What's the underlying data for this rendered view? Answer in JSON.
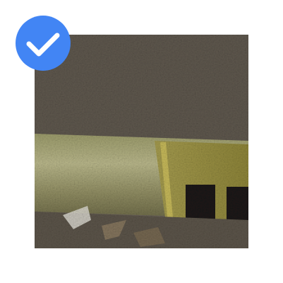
{
  "tile": {
    "selected": true,
    "accent_color": "#4285f4",
    "check_color": "#ffffff"
  },
  "icons": {
    "selection": "checkmark-circle-icon"
  }
}
